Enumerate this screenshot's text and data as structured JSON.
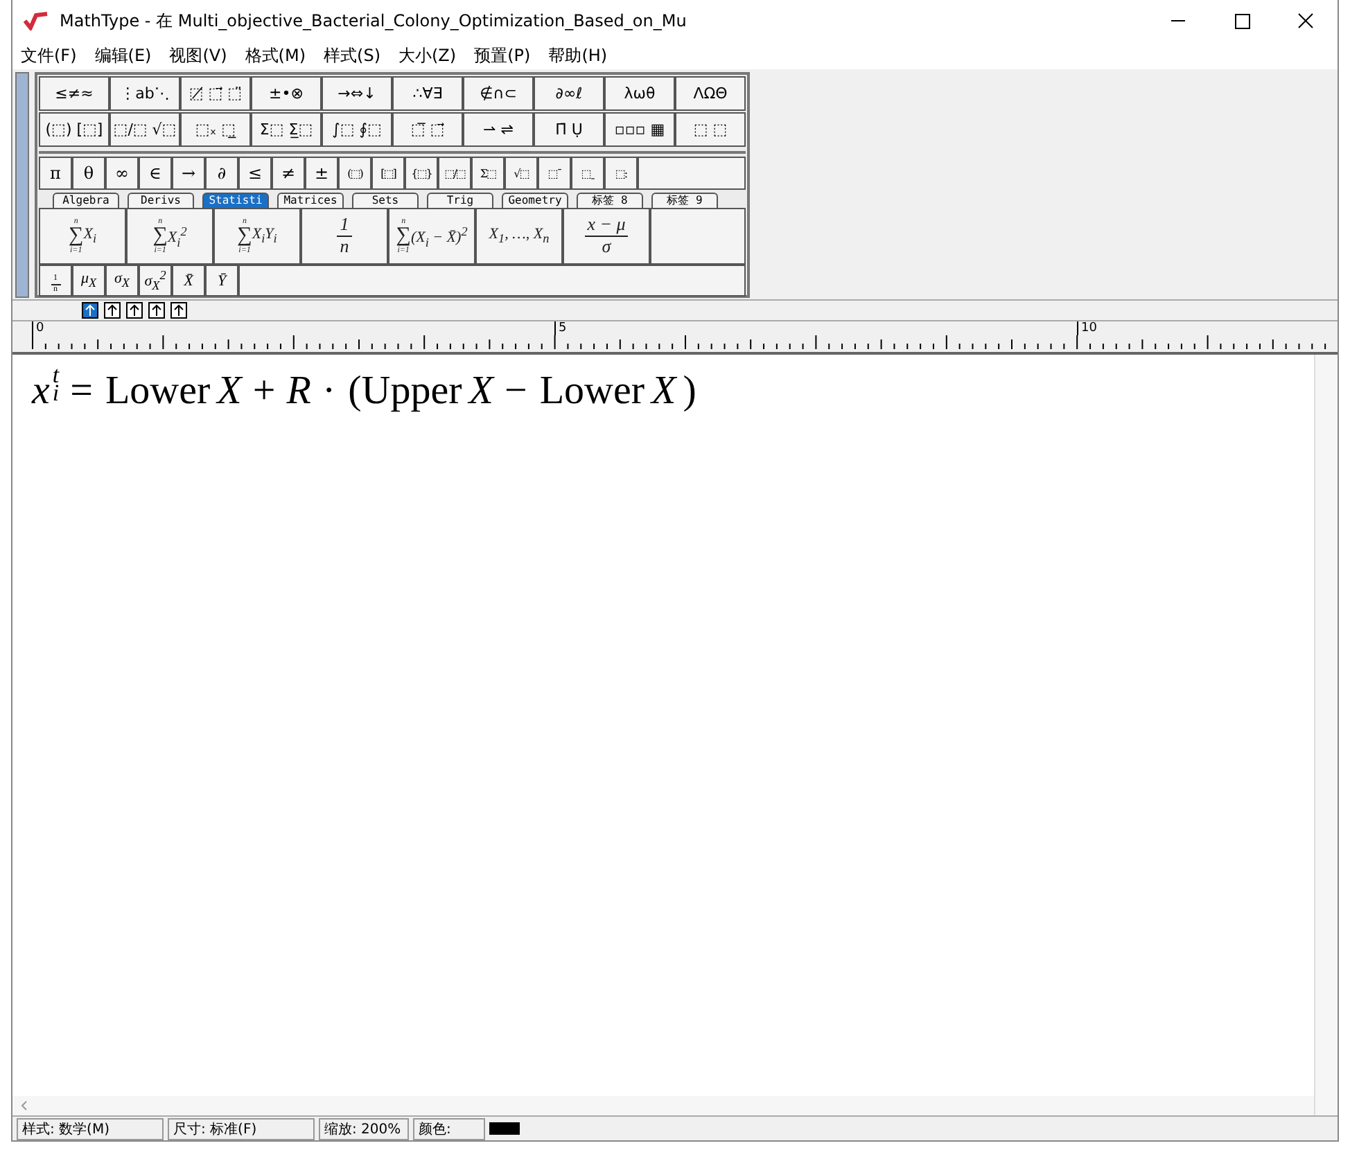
{
  "window": {
    "title": "MathType - 在 Multi_objective_Bacterial_Colony_Optimization_Based_on_Mu"
  },
  "menu": [
    "文件(F)",
    "编辑(E)",
    "视图(V)",
    "格式(M)",
    "样式(S)",
    "大小(Z)",
    "预置(P)",
    "帮助(H)"
  ],
  "palette": {
    "symbol_rows": [
      [
        "≤≠≈",
        "⋮ab⋱",
        "⬚̸ ⬚⃗ ⬚̈",
        "±•⊗",
        "→⇔↓",
        "∴∀∃",
        "∉∩⊂",
        "∂∞ℓ",
        "λωθ",
        "ΛΩΘ"
      ],
      [
        "(⬚) [⬚]",
        "⬚/⬚ √⬚",
        "⬚ₓ ⬚̲",
        "Σ⬚ Σ̲⬚",
        "∫⬚ ∮⬚",
        "⬚̅ ⬚⃗",
        "⇀ ⇌",
        "Π̄ Ụ",
        "▫▫▫ ▦",
        "⬚ ⬚"
      ]
    ],
    "small_symbols": [
      "π",
      "θ",
      "∞",
      "∈",
      "→",
      "∂",
      "≤",
      "≠",
      "±",
      "(⬚)",
      "[⬚]",
      "{⬚}",
      "⬚/⬚",
      "Σ⬚",
      "√⬚",
      "⬚ˉ",
      "⬚ˍ",
      "⬚:"
    ],
    "tabs": [
      {
        "label": "Algebra",
        "selected": false
      },
      {
        "label": "Derivs",
        "selected": false
      },
      {
        "label": "Statisti",
        "selected": true
      },
      {
        "label": "Matrices",
        "selected": false
      },
      {
        "label": "Sets",
        "selected": false
      },
      {
        "label": "Trig",
        "selected": false
      },
      {
        "label": "Geometry",
        "selected": false
      },
      {
        "label": "标签 8",
        "selected": false
      },
      {
        "label": "标签 9",
        "selected": false
      }
    ],
    "templates": [
      {
        "kind": "sum",
        "symbol": "∑",
        "upper": "n",
        "lower": "i=1",
        "body": "X$_{i}$"
      },
      {
        "kind": "sum",
        "symbol": "∑",
        "upper": "n",
        "lower": "i=1",
        "body": "X$_{i}$$^{2}$"
      },
      {
        "kind": "sum",
        "symbol": "∑",
        "upper": "n",
        "lower": "i=1",
        "body": "X$_{i}$Y$_{i}$"
      },
      {
        "kind": "fraction",
        "num": "1",
        "den": "n"
      },
      {
        "kind": "sum",
        "symbol": "∑",
        "upper": "n",
        "lower": "i=1",
        "body": "(X$_{i}$ − X̄)$^{2}$"
      },
      {
        "kind": "expr",
        "body": "X$_{1}$, …, X$_{n}$"
      },
      {
        "kind": "fraction",
        "num": "x − μ",
        "den": "σ"
      }
    ],
    "small_templates": [
      {
        "kind": "fraction",
        "num": "1",
        "den": "n"
      },
      {
        "kind": "expr",
        "body": "μ$_{X}$"
      },
      {
        "kind": "expr",
        "body": "σ$_{X}$"
      },
      {
        "kind": "expr",
        "body": "σ$_{X}$$^{2}$"
      },
      {
        "kind": "expr",
        "body": "X̄"
      },
      {
        "kind": "expr",
        "body": "Ȳ"
      }
    ]
  },
  "nudge_buttons": [
    {
      "selected": true
    },
    {
      "selected": false
    },
    {
      "selected": false
    },
    {
      "selected": false
    },
    {
      "selected": false
    }
  ],
  "ruler": {
    "labels": [
      "0",
      "5",
      "10"
    ]
  },
  "equation": [
    {
      "kind": "var",
      "text": "x",
      "sub": "i",
      "sup": "t"
    },
    {
      "kind": "op",
      "text": "="
    },
    {
      "kind": "text",
      "text": "Lower"
    },
    {
      "kind": "var",
      "text": "X"
    },
    {
      "kind": "op",
      "text": "+"
    },
    {
      "kind": "var",
      "text": "R"
    },
    {
      "kind": "op",
      "text": "·"
    },
    {
      "kind": "text",
      "text": "(Upper"
    },
    {
      "kind": "var",
      "text": "X"
    },
    {
      "kind": "op",
      "text": "−"
    },
    {
      "kind": "text",
      "text": "Lower"
    },
    {
      "kind": "var",
      "text": "X"
    },
    {
      "kind": "text",
      "text": ")"
    }
  ],
  "status_bar": {
    "fields": [
      "样式: 数学(M)",
      "尺寸: 标准(F)",
      "缩放: 200%",
      "颜色:"
    ],
    "color": "#000000"
  }
}
